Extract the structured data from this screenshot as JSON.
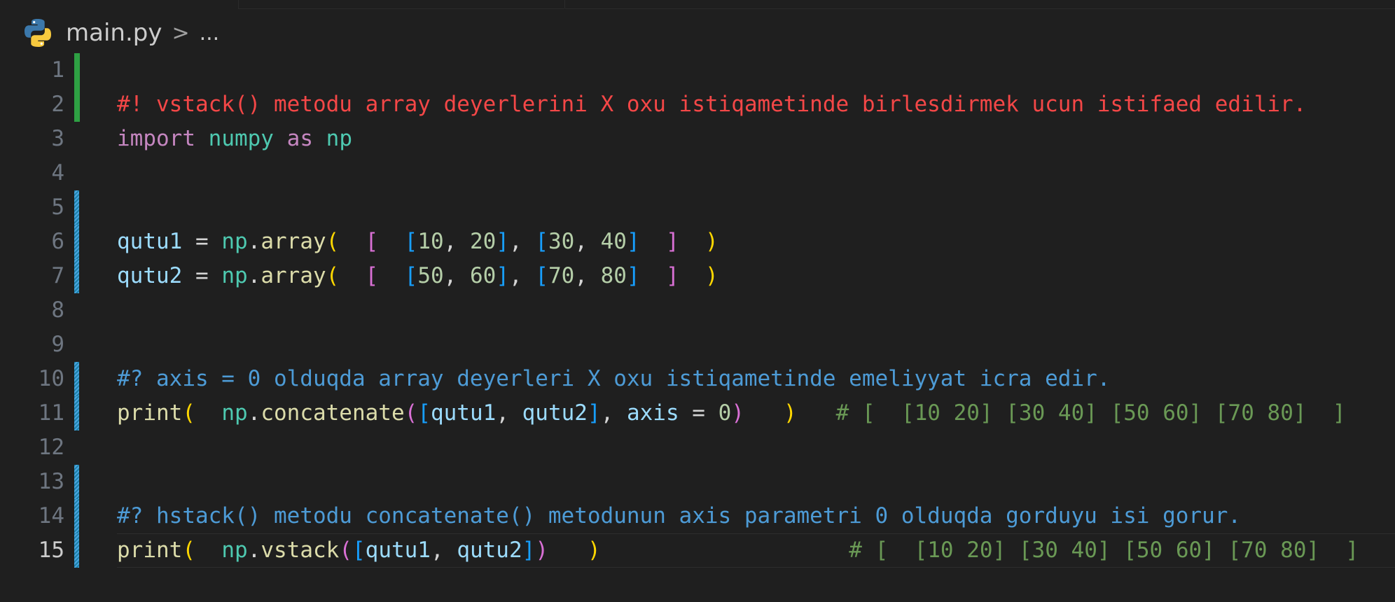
{
  "breadcrumb": {
    "file": "main.py",
    "separator": ">",
    "more": "..."
  },
  "icons": {
    "file_icon": "python-icon",
    "separator_icon": "chevron-right-icon"
  },
  "colors": {
    "background": "#1f1f1f",
    "gutter_added": "#2ea043",
    "gutter_modified": "#1b81a8",
    "comment_red": "#f44747",
    "comment_blue": "#4d9bd6",
    "comment_green": "#6a9955"
  },
  "editor": {
    "current_line": 15,
    "lines": [
      {
        "n": "1",
        "tokens": []
      },
      {
        "n": "2",
        "tokens": [
          {
            "t": "#! vstack() metodu array deyerlerini X oxu istiqametinde birlesdirmek ucun istifaed edilir.",
            "c": "c-red"
          }
        ]
      },
      {
        "n": "3",
        "tokens": [
          {
            "t": "import",
            "c": "c-kw"
          },
          {
            "t": " ",
            "c": "c-op"
          },
          {
            "t": "numpy",
            "c": "c-mod"
          },
          {
            "t": " ",
            "c": "c-op"
          },
          {
            "t": "as",
            "c": "c-kw"
          },
          {
            "t": " ",
            "c": "c-op"
          },
          {
            "t": "np",
            "c": "c-mod"
          }
        ]
      },
      {
        "n": "4",
        "tokens": []
      },
      {
        "n": "5",
        "tokens": []
      },
      {
        "n": "6",
        "tokens": [
          {
            "t": "qutu1",
            "c": "c-var"
          },
          {
            "t": " = ",
            "c": "c-op"
          },
          {
            "t": "np",
            "c": "c-mod"
          },
          {
            "t": ".",
            "c": "c-op"
          },
          {
            "t": "array",
            "c": "c-fn"
          },
          {
            "t": "(",
            "c": "b-gold"
          },
          {
            "t": "  ",
            "c": "c-op"
          },
          {
            "t": "[",
            "c": "b-pink"
          },
          {
            "t": "  ",
            "c": "c-op"
          },
          {
            "t": "[",
            "c": "b-blue"
          },
          {
            "t": "10",
            "c": "c-num"
          },
          {
            "t": ", ",
            "c": "c-op"
          },
          {
            "t": "20",
            "c": "c-num"
          },
          {
            "t": "]",
            "c": "b-blue"
          },
          {
            "t": ", ",
            "c": "c-op"
          },
          {
            "t": "[",
            "c": "b-blue"
          },
          {
            "t": "30",
            "c": "c-num"
          },
          {
            "t": ", ",
            "c": "c-op"
          },
          {
            "t": "40",
            "c": "c-num"
          },
          {
            "t": "]",
            "c": "b-blue"
          },
          {
            "t": "  ",
            "c": "c-op"
          },
          {
            "t": "]",
            "c": "b-pink"
          },
          {
            "t": "  ",
            "c": "c-op"
          },
          {
            "t": ")",
            "c": "b-gold"
          }
        ]
      },
      {
        "n": "7",
        "tokens": [
          {
            "t": "qutu2",
            "c": "c-var"
          },
          {
            "t": " = ",
            "c": "c-op"
          },
          {
            "t": "np",
            "c": "c-mod"
          },
          {
            "t": ".",
            "c": "c-op"
          },
          {
            "t": "array",
            "c": "c-fn"
          },
          {
            "t": "(",
            "c": "b-gold"
          },
          {
            "t": "  ",
            "c": "c-op"
          },
          {
            "t": "[",
            "c": "b-pink"
          },
          {
            "t": "  ",
            "c": "c-op"
          },
          {
            "t": "[",
            "c": "b-blue"
          },
          {
            "t": "50",
            "c": "c-num"
          },
          {
            "t": ", ",
            "c": "c-op"
          },
          {
            "t": "60",
            "c": "c-num"
          },
          {
            "t": "]",
            "c": "b-blue"
          },
          {
            "t": ", ",
            "c": "c-op"
          },
          {
            "t": "[",
            "c": "b-blue"
          },
          {
            "t": "70",
            "c": "c-num"
          },
          {
            "t": ", ",
            "c": "c-op"
          },
          {
            "t": "80",
            "c": "c-num"
          },
          {
            "t": "]",
            "c": "b-blue"
          },
          {
            "t": "  ",
            "c": "c-op"
          },
          {
            "t": "]",
            "c": "b-pink"
          },
          {
            "t": "  ",
            "c": "c-op"
          },
          {
            "t": ")",
            "c": "b-gold"
          }
        ]
      },
      {
        "n": "8",
        "tokens": []
      },
      {
        "n": "9",
        "tokens": []
      },
      {
        "n": "10",
        "tokens": [
          {
            "t": "#? axis = 0 olduqda array deyerleri X oxu istiqametinde emeliyyat icra edir.",
            "c": "c-blue"
          }
        ]
      },
      {
        "n": "11",
        "tokens": [
          {
            "t": "print",
            "c": "c-fn"
          },
          {
            "t": "(",
            "c": "b-gold"
          },
          {
            "t": "  ",
            "c": "c-op"
          },
          {
            "t": "np",
            "c": "c-mod"
          },
          {
            "t": ".",
            "c": "c-op"
          },
          {
            "t": "concatenate",
            "c": "c-fn"
          },
          {
            "t": "(",
            "c": "b-pink"
          },
          {
            "t": "[",
            "c": "b-blue"
          },
          {
            "t": "qutu1",
            "c": "c-var"
          },
          {
            "t": ", ",
            "c": "c-op"
          },
          {
            "t": "qutu2",
            "c": "c-var"
          },
          {
            "t": "]",
            "c": "b-blue"
          },
          {
            "t": ", ",
            "c": "c-op"
          },
          {
            "t": "axis",
            "c": "c-var"
          },
          {
            "t": " = ",
            "c": "c-op"
          },
          {
            "t": "0",
            "c": "c-num"
          },
          {
            "t": ")",
            "c": "b-pink"
          },
          {
            "t": "   ",
            "c": "c-op"
          },
          {
            "t": ")",
            "c": "b-gold"
          },
          {
            "t": "   ",
            "c": "c-op"
          },
          {
            "t": "# [  [10 20] [30 40] [50 60] [70 80]  ]",
            "c": "c-comment"
          }
        ]
      },
      {
        "n": "12",
        "tokens": []
      },
      {
        "n": "13",
        "tokens": []
      },
      {
        "n": "14",
        "tokens": [
          {
            "t": "#? hstack() metodu concatenate() metodunun axis parametri 0 olduqda gorduyu isi gorur.",
            "c": "c-blue"
          }
        ]
      },
      {
        "n": "15",
        "tokens": [
          {
            "t": "print",
            "c": "c-fn"
          },
          {
            "t": "(",
            "c": "b-gold"
          },
          {
            "t": "  ",
            "c": "c-op"
          },
          {
            "t": "np",
            "c": "c-mod"
          },
          {
            "t": ".",
            "c": "c-op"
          },
          {
            "t": "vstack",
            "c": "c-fn"
          },
          {
            "t": "(",
            "c": "b-pink"
          },
          {
            "t": "[",
            "c": "b-blue"
          },
          {
            "t": "qutu1",
            "c": "c-var"
          },
          {
            "t": ", ",
            "c": "c-op"
          },
          {
            "t": "qutu2",
            "c": "c-var"
          },
          {
            "t": "]",
            "c": "b-blue"
          },
          {
            "t": ")",
            "c": "b-pink"
          },
          {
            "t": "   ",
            "c": "c-op"
          },
          {
            "t": ")",
            "c": "b-gold"
          },
          {
            "t": "                   ",
            "c": "c-op"
          },
          {
            "t": "# [  [10 20] [30 40] [50 60] [70 80]  ]",
            "c": "c-comment"
          }
        ]
      }
    ]
  }
}
